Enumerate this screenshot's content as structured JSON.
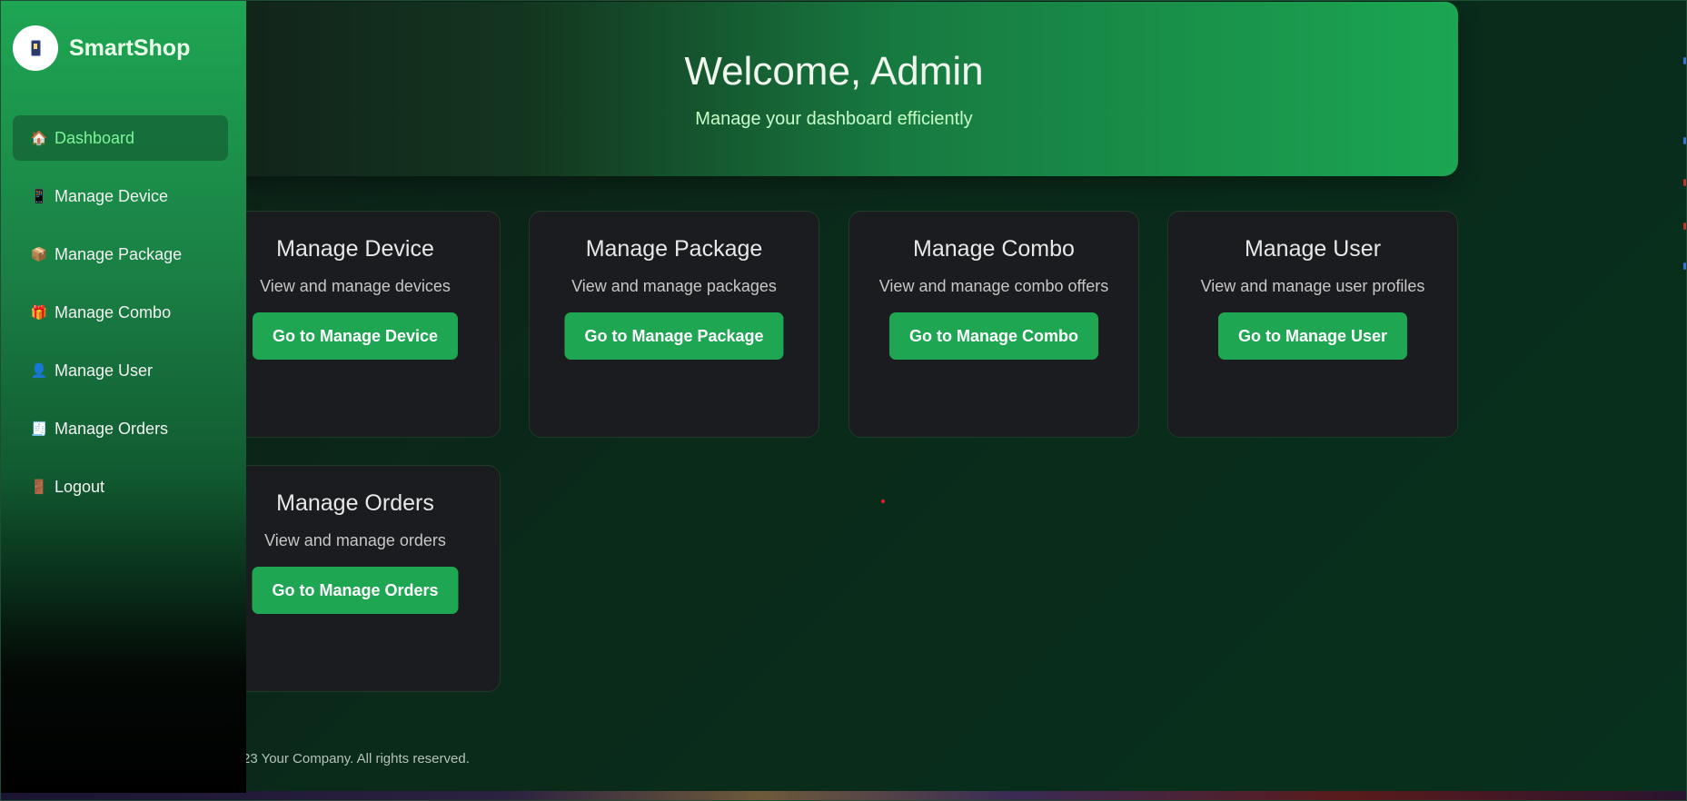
{
  "brand": {
    "name": "SmartShop",
    "logo_icon": "phone-icon"
  },
  "sidebar": {
    "items": [
      {
        "label": "Dashboard",
        "icon": "🏠",
        "active": true
      },
      {
        "label": "Manage Device",
        "icon": "📱",
        "active": false
      },
      {
        "label": "Manage Package",
        "icon": "📦",
        "active": false
      },
      {
        "label": "Manage Combo",
        "icon": "🎁",
        "active": false
      },
      {
        "label": "Manage User",
        "icon": "👤",
        "active": false
      },
      {
        "label": "Manage Orders",
        "icon": "🧾",
        "active": false
      },
      {
        "label": "Logout",
        "icon": "🚪",
        "active": false
      }
    ]
  },
  "header": {
    "title": "Welcome, Admin",
    "subtitle": "Manage your dashboard efficiently"
  },
  "cards": [
    {
      "title": "Manage Device",
      "description": "View and manage devices",
      "button": "Go to Manage Device"
    },
    {
      "title": "Manage Package",
      "description": "View and manage packages",
      "button": "Go to Manage Package"
    },
    {
      "title": "Manage Combo",
      "description": "View and manage combo offers",
      "button": "Go to Manage Combo"
    },
    {
      "title": "Manage User",
      "description": "View and manage user profiles",
      "button": "Go to Manage User"
    },
    {
      "title": "Manage Orders",
      "description": "View and manage orders",
      "button": "Go to Manage Orders"
    }
  ],
  "footer": {
    "text": "23 Your Company. All rights reserved."
  },
  "colors": {
    "accent": "#1ea653",
    "active_text": "#7ef59a",
    "card_bg": "#1b1c1f",
    "background": "#0a2a1a"
  }
}
